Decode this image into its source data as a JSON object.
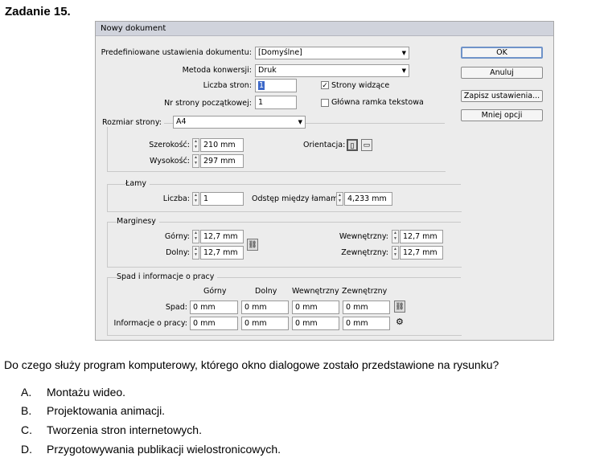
{
  "task_title": "Zadanie 15.",
  "dialog": {
    "title": "Nowy dokument",
    "preset_label": "Predefiniowane ustawienia dokumentu:",
    "preset_value": "[Domyślne]",
    "conversion_label": "Metoda konwersji:",
    "conversion_value": "Druk",
    "pages_label": "Liczba stron:",
    "pages_value": "1",
    "start_page_label": "Nr strony początkowej:",
    "start_page_value": "1",
    "facing_pages_label": "Strony widzące",
    "facing_pages_checked": true,
    "master_frame_label": "Główna ramka tekstowa",
    "master_frame_checked": false,
    "page_size_label": "Rozmiar strony:",
    "page_size_value": "A4",
    "width_label": "Szerokość:",
    "width_value": "210 mm",
    "height_label": "Wysokość:",
    "height_value": "297 mm",
    "orientation_label": "Orientacja:",
    "columns_title": "Łamy",
    "columns_count_label": "Liczba:",
    "columns_count_value": "1",
    "gutter_label": "Odstęp między łamami:",
    "gutter_value": "4,233 mm",
    "margins_title": "Marginesy",
    "top_label": "Górny:",
    "top_value": "12,7 mm",
    "bottom_label": "Dolny:",
    "bottom_value": "12,7 mm",
    "inside_label": "Wewnętrzny:",
    "inside_value": "12,7 mm",
    "outside_label": "Zewnętrzny:",
    "outside_value": "12,7 mm",
    "bleed_title": "Spad i informacje o pracy",
    "col_top": "Górny",
    "col_bottom": "Dolny",
    "col_inside": "Wewnętrzny",
    "col_outside": "Zewnętrzny",
    "bleed_label": "Spad:",
    "slug_label": "Informacje o pracy:",
    "bleed_values": [
      "0 mm",
      "0 mm",
      "0 mm",
      "0 mm"
    ],
    "slug_values": [
      "0 mm",
      "0 mm",
      "0 mm",
      "0 mm"
    ],
    "buttons": {
      "ok": "OK",
      "cancel": "Anuluj",
      "save_preset": "Zapisz ustawienia...",
      "fewer_options": "Mniej opcji"
    }
  },
  "question": "Do czego służy program komputerowy, którego okno dialogowe zostało przedstawione na rysunku?",
  "answers": [
    {
      "letter": "A.",
      "text": "Montażu wideo."
    },
    {
      "letter": "B.",
      "text": "Projektowania animacji."
    },
    {
      "letter": "C.",
      "text": "Tworzenia stron internetowych."
    },
    {
      "letter": "D.",
      "text": "Przygotowywania publikacji wielostronicowych."
    }
  ]
}
